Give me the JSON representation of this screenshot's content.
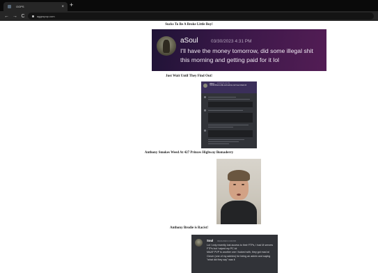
{
  "browser": {
    "tab_title": "OOPS",
    "tab_close": "×",
    "new_tab": "+",
    "back": "←",
    "forward": "→",
    "reload": "C",
    "url": "aggropop.com"
  },
  "captions": [
    "Sucks To Be A Broke Little Boy!",
    "Just Wait Until They Find Out!",
    "Anthony Smokes Weed At 427 Princes Highway Bomaderry",
    "Anthony Brodie is Racist!"
  ],
  "post1": {
    "username": "aSoul",
    "timestamp": "03/30/2023 4:31 PM",
    "message": "I'll have the money tomorrow, did some illegal shit this morning and getting paid for it lol"
  },
  "post2": {
    "username": "aSoul",
    "timestamp": "03/30/2023 4:31 PM",
    "message": "I kinda fibbed a little and said we can't see tickets lol"
  },
  "post4": {
    "username": "Soul",
    "timestamp": "03/21/2023 4:39 PM",
    "message": "Lol I only recently lost access to their FTPs, I had M servers FTPs but I wiped my PC lol\nMAAF PVP is another one I fucked with, they got mad at Clover (one of my admins) for being an admin and saying \"what did they say\" was it"
  },
  "colors": {
    "discord_bg": "#313338",
    "purple_banner": "#3a1848",
    "chrome_dark": "#0a0a0a"
  },
  "icons": {
    "tab_favicon": "square",
    "lock": "lock-icon"
  }
}
